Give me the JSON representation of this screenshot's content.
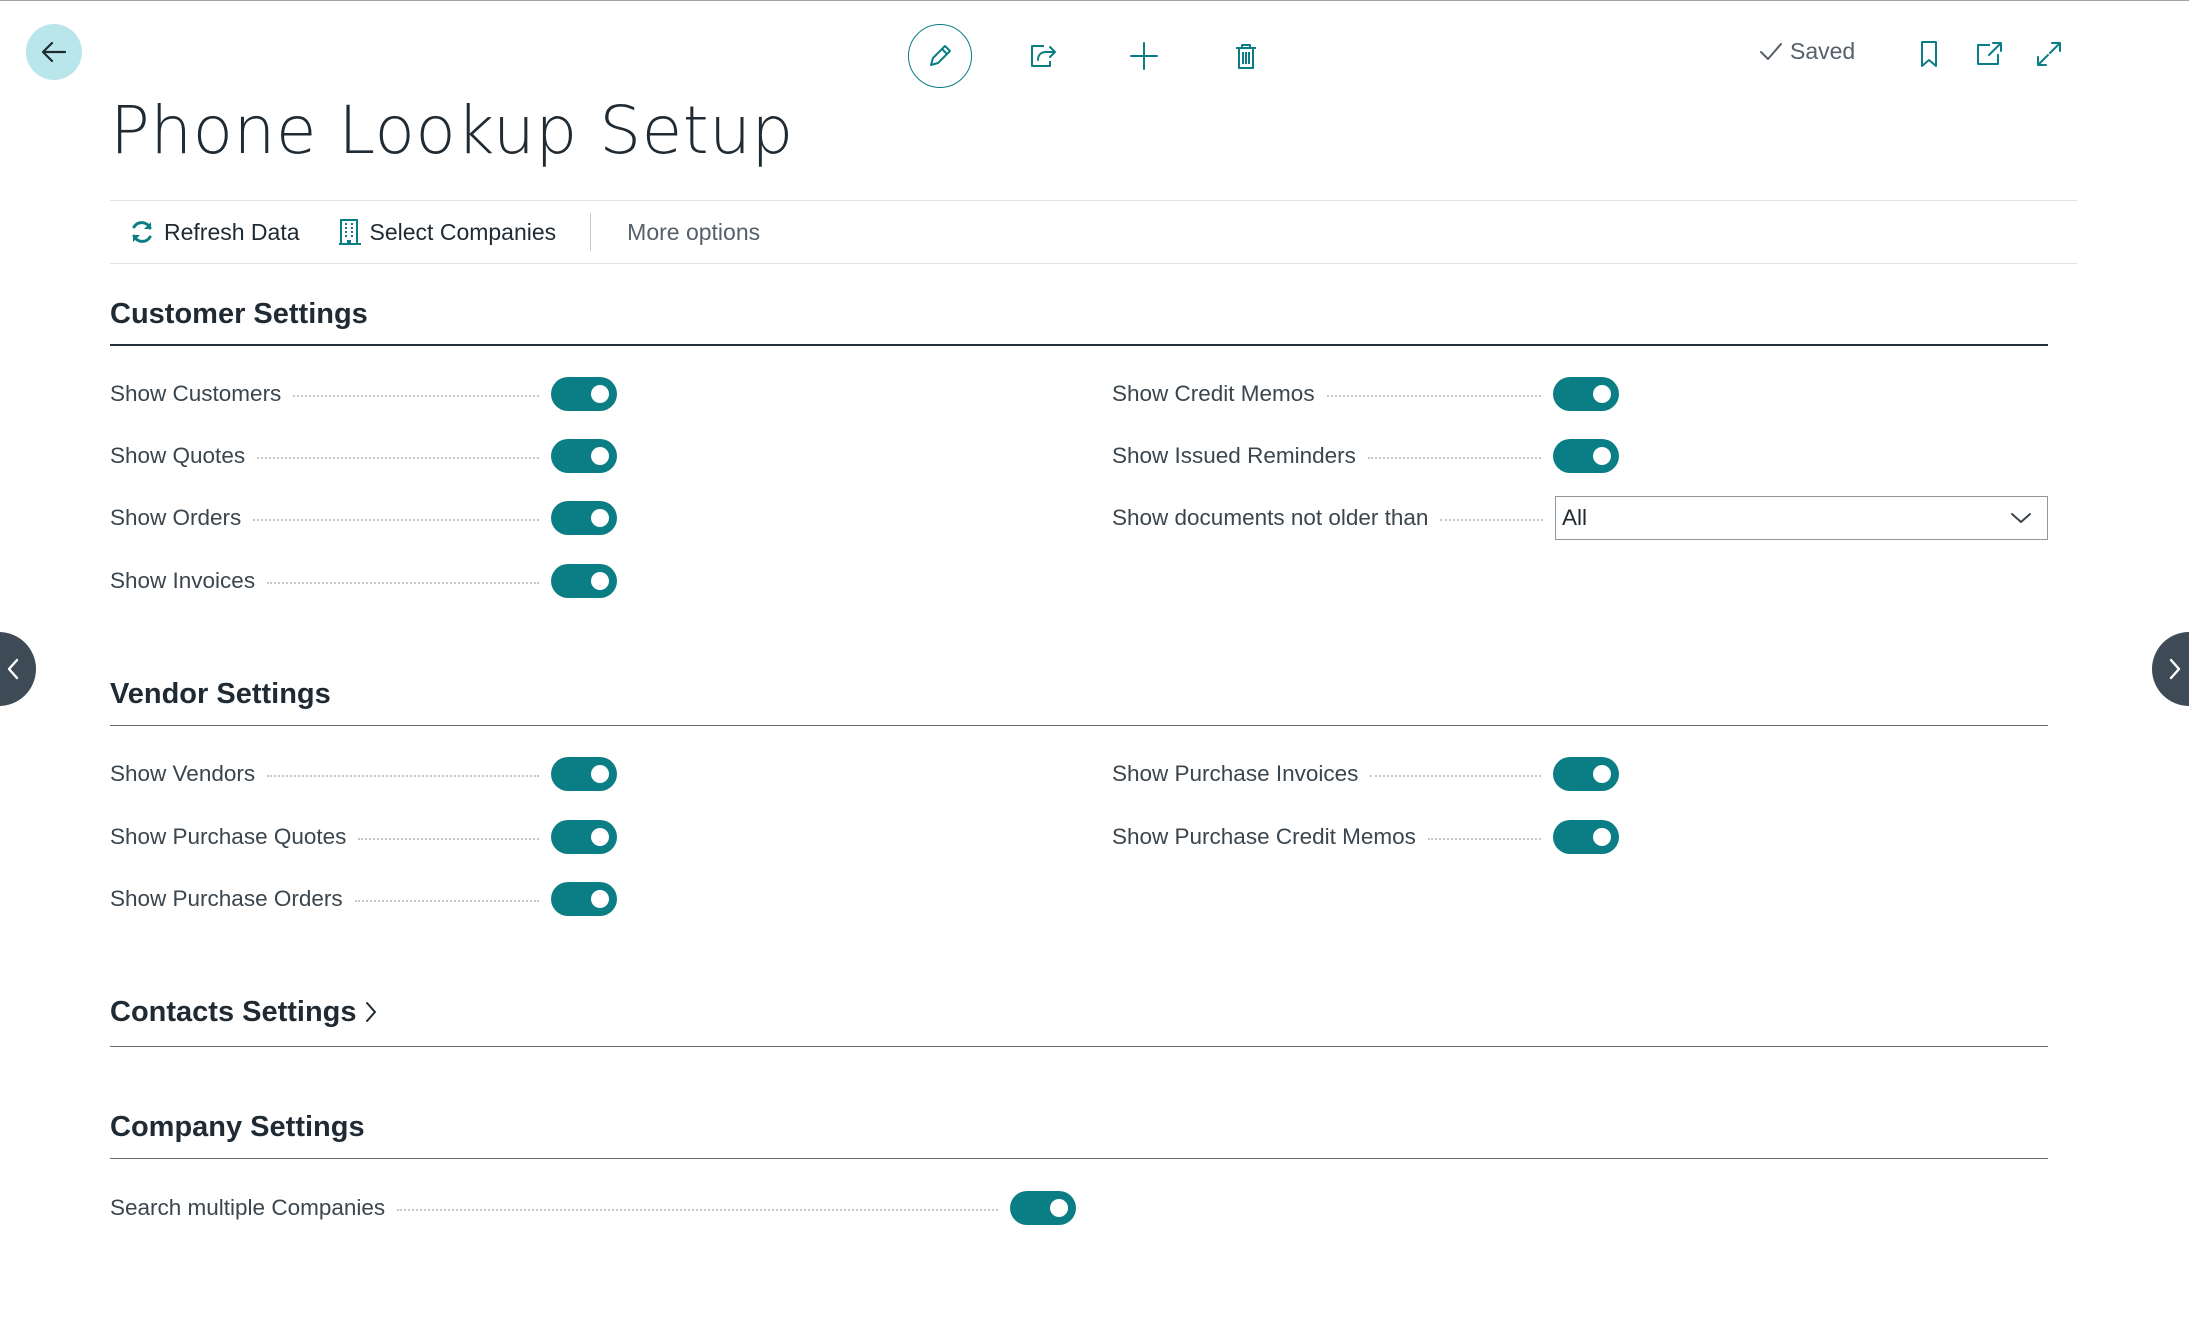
{
  "app": {
    "page_title": "Phone Lookup Setup",
    "status": "Saved"
  },
  "actions": {
    "refresh": "Refresh Data",
    "select_companies": "Select Companies",
    "more": "More options"
  },
  "customer_settings": {
    "title": "Customer Settings",
    "show_customers": "Show Customers",
    "show_quotes": "Show Quotes",
    "show_orders": "Show Orders",
    "show_invoices": "Show Invoices",
    "show_credit_memos": "Show Credit Memos",
    "show_issued_reminders": "Show Issued Reminders",
    "show_documents_not_older_than": "Show documents not older than",
    "documents_age_value": "All"
  },
  "vendor_settings": {
    "title": "Vendor Settings",
    "show_vendors": "Show Vendors",
    "show_purchase_quotes": "Show Purchase Quotes",
    "show_purchase_orders": "Show Purchase Orders",
    "show_purchase_invoices": "Show Purchase Invoices",
    "show_purchase_credit_memos": "Show Purchase Credit Memos"
  },
  "contacts_settings": {
    "title": "Contacts Settings"
  },
  "company_settings": {
    "title": "Company Settings",
    "search_multiple_companies": "Search multiple Companies"
  },
  "toggles": {
    "show_customers": true,
    "show_quotes": true,
    "show_orders": true,
    "show_invoices": true,
    "show_credit_memos": true,
    "show_issued_reminders": true,
    "show_vendors": true,
    "show_purchase_quotes": true,
    "show_purchase_orders": true,
    "show_purchase_invoices": true,
    "show_purchase_credit_memos": true,
    "search_multiple_companies": true
  },
  "colors": {
    "accent": "#0b7d84",
    "back_button_bg": "#b9e6ea",
    "side_nav_bg": "#3e4a56"
  },
  "icons": {
    "back": "arrow-left-icon",
    "edit": "pencil-icon",
    "share": "share-icon",
    "new": "plus-icon",
    "delete": "trash-icon",
    "saved": "checkmark-icon",
    "bookmark": "bookmark-icon",
    "open_new_window": "open-new-window-icon",
    "expand": "expand-icon",
    "refresh": "refresh-icon",
    "companies": "building-icon",
    "dropdown": "chevron-down-icon",
    "section_collapsed": "chevron-right-icon",
    "prev": "chevron-left-icon",
    "next": "chevron-right-icon"
  }
}
